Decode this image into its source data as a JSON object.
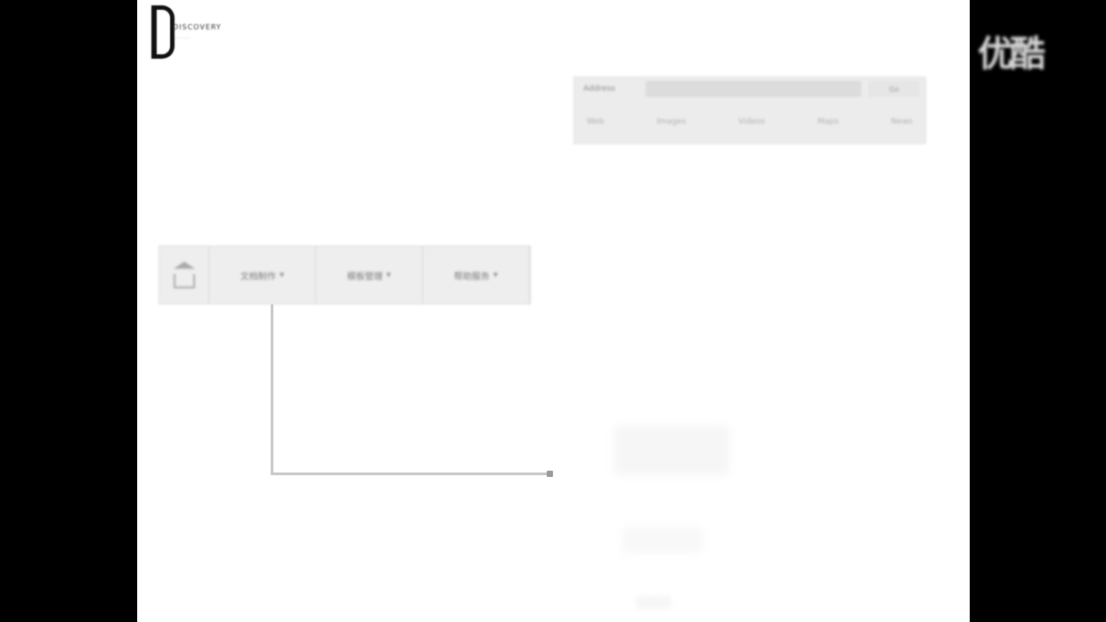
{
  "logo": {
    "text": "DISCOVERY",
    "subtext": "· · · · ·"
  },
  "address_bar": {
    "label": "Address",
    "value": "",
    "go_label": "Go",
    "row2": [
      "Web",
      "Images",
      "Videos",
      "Maps",
      "News"
    ]
  },
  "toolbar": {
    "tabs": [
      {
        "label": "文档制作",
        "caret": "▼"
      },
      {
        "label": "模板管理",
        "caret": "▼"
      },
      {
        "label": "帮助服务",
        "caret": "▼"
      }
    ]
  },
  "watermark": {
    "text": "优酷"
  },
  "colors": {
    "background": "#000000",
    "slide": "#ffffff",
    "toolbar": "#eeeeee",
    "connector": "#c8c8c8"
  }
}
